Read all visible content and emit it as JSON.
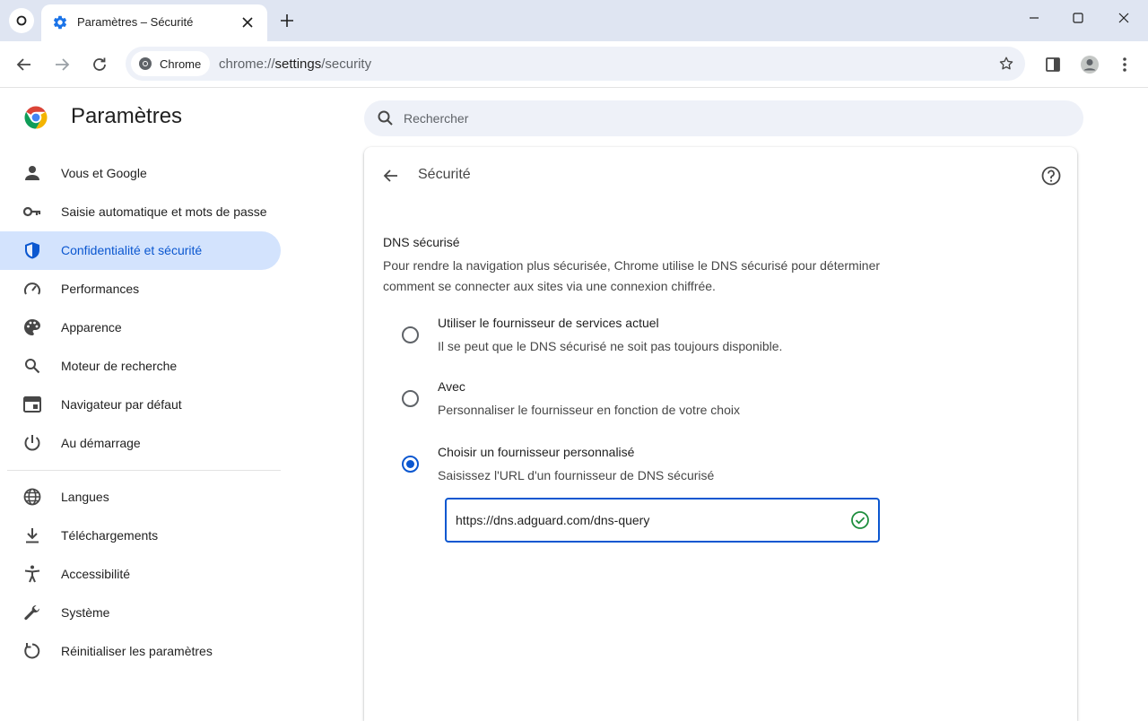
{
  "tab": {
    "title": "Paramètres – Sécurité"
  },
  "omnibox": {
    "chip_label": "Chrome",
    "url_scheme": "chrome://",
    "url_host": "settings",
    "url_path": "/security"
  },
  "header": {
    "app_title": "Paramètres",
    "search_placeholder": "Rechercher"
  },
  "sidebar": {
    "items": [
      {
        "label": "Vous et Google",
        "icon": "person-icon"
      },
      {
        "label": "Saisie automatique et mots de passe",
        "icon": "key-icon"
      },
      {
        "label": "Confidentialité et sécurité",
        "icon": "shield-icon",
        "active": true
      },
      {
        "label": "Performances",
        "icon": "speedometer-icon"
      },
      {
        "label": "Apparence",
        "icon": "palette-icon"
      },
      {
        "label": "Moteur de recherche",
        "icon": "search-icon"
      },
      {
        "label": "Navigateur par défaut",
        "icon": "browser-window-icon"
      },
      {
        "label": "Au démarrage",
        "icon": "power-icon"
      },
      {
        "label": "Langues",
        "icon": "globe-icon"
      },
      {
        "label": "Téléchargements",
        "icon": "download-icon"
      },
      {
        "label": "Accessibilité",
        "icon": "accessibility-icon"
      },
      {
        "label": "Système",
        "icon": "wrench-icon"
      },
      {
        "label": "Réinitialiser les paramètres",
        "icon": "reset-icon"
      }
    ]
  },
  "main": {
    "page_title": "Sécurité",
    "dns": {
      "title": "DNS sécurisé",
      "description": "Pour rendre la navigation plus sécurisée, Chrome utilise le DNS sécurisé pour déterminer comment se connecter aux sites via une connexion chiffrée.",
      "options": [
        {
          "label": "Utiliser le fournisseur de services actuel",
          "sub": "Il se peut que le DNS sécurisé ne soit pas toujours disponible.",
          "selected": false
        },
        {
          "label": "Avec",
          "sub": "Personnaliser le fournisseur en fonction de votre choix",
          "selected": false
        },
        {
          "label": "Choisir un fournisseur personnalisé",
          "sub": "Saisissez l'URL d'un fournisseur de DNS sécurisé",
          "selected": true
        }
      ],
      "custom_url": "https://dns.adguard.com/dns-query"
    }
  },
  "colors": {
    "accent": "#0b57d0",
    "active_nav_bg": "#d3e3fd",
    "tabstrip_bg": "#dfe5f2",
    "valid_green": "#1e8e3e"
  }
}
